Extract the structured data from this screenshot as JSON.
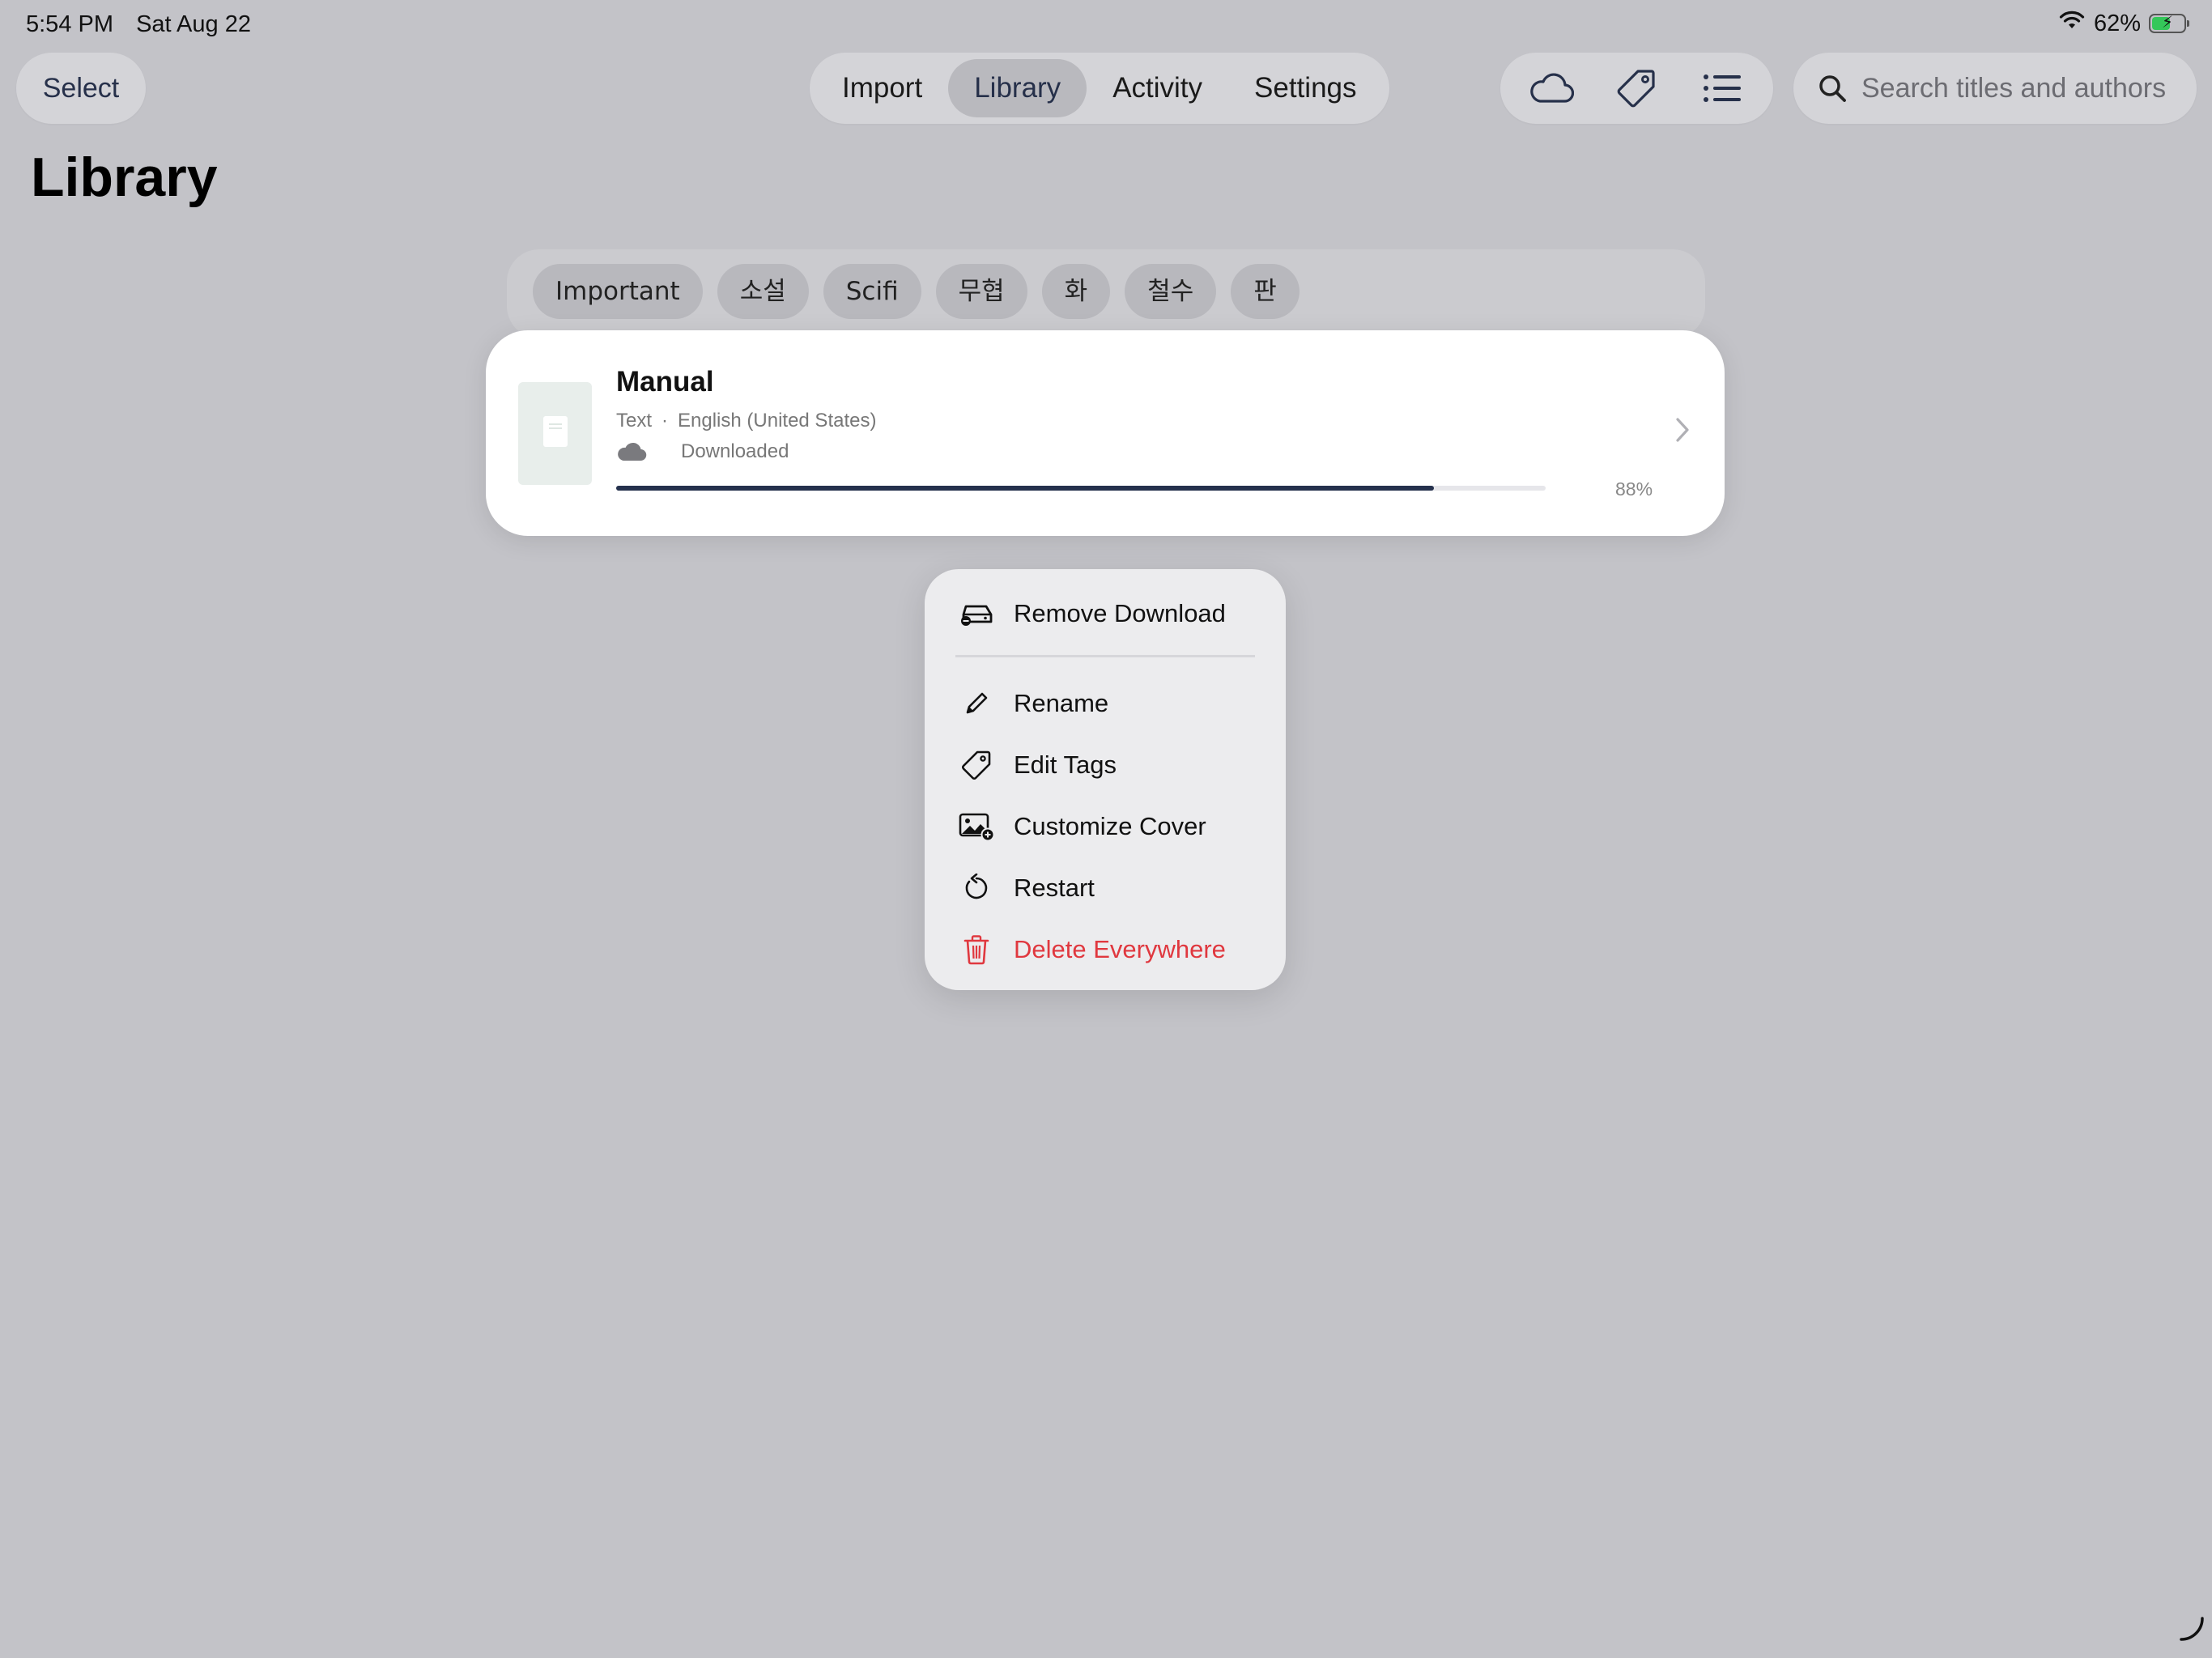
{
  "status_bar": {
    "time": "5:54 PM",
    "date": "Sat Aug 22",
    "battery": "62%",
    "battery_level": 0.62,
    "battery_color": "#34c759"
  },
  "toolbar": {
    "select_label": "Select",
    "tabs": [
      {
        "label": "Import",
        "active": false
      },
      {
        "label": "Library",
        "active": true
      },
      {
        "label": "Activity",
        "active": false
      },
      {
        "label": "Settings",
        "active": false
      }
    ],
    "icons": [
      "cloud-icon",
      "tag-icon",
      "list-icon"
    ],
    "search_placeholder": "Search titles and authors"
  },
  "page_title": "Library",
  "tags": [
    "Important",
    "소설",
    "Scifi",
    "무협",
    "화",
    "철수",
    "판"
  ],
  "book": {
    "title": "Manual",
    "type": "Text",
    "language": "English (United States)",
    "status": "Downloaded",
    "progress_label": "88%",
    "progress": 0.88,
    "progress_color": "#25314d"
  },
  "context_menu": {
    "items": [
      {
        "label": "Remove Download",
        "icon": "remove-download-icon"
      },
      {
        "label": "Rename",
        "icon": "pencil-icon"
      },
      {
        "label": "Edit Tags",
        "icon": "tag-icon"
      },
      {
        "label": "Customize Cover",
        "icon": "photo-add-icon"
      },
      {
        "label": "Restart",
        "icon": "restart-icon"
      },
      {
        "label": "Delete Everywhere",
        "icon": "trash-icon",
        "destructive": true
      }
    ],
    "destructive_color": "#e0383f"
  }
}
